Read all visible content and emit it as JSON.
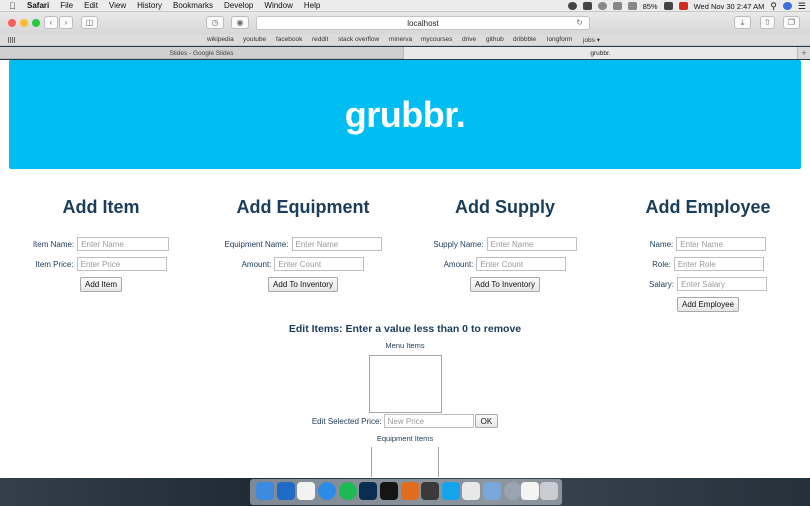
{
  "menubar": {
    "app": "Safari",
    "menus": [
      "File",
      "Edit",
      "View",
      "History",
      "Bookmarks",
      "Develop",
      "Window",
      "Help"
    ],
    "battery": "85%",
    "datetime": "Wed Nov 30  2:47 AM"
  },
  "browser": {
    "url": "localhost",
    "favorites": [
      "wikipedia",
      "youtube",
      "facebook",
      "reddit",
      "stack overflow",
      "minerva",
      "mycourses",
      "drive",
      "github",
      "dribbble",
      "longform",
      "jobs ▾"
    ],
    "tabs": [
      "Slides - Google Slides",
      "grubbr."
    ],
    "new_tab": "+"
  },
  "page": {
    "brand": "grubbr.",
    "add_item": {
      "title": "Add Item",
      "name_label": "Item Name:",
      "name_placeholder": "Enter Name",
      "price_label": "Item Price:",
      "price_placeholder": "Enter Price",
      "button": "Add Item"
    },
    "add_equipment": {
      "title": "Add Equipment",
      "name_label": "Equipment Name:",
      "name_placeholder": "Enter Name",
      "amount_label": "Amount:",
      "amount_placeholder": "Enter Count",
      "button": "Add To Inventory"
    },
    "add_supply": {
      "title": "Add Supply",
      "name_label": "Supply Name:",
      "name_placeholder": "Enter Name",
      "amount_label": "Amount:",
      "amount_placeholder": "Enter Count",
      "button": "Add To Inventory"
    },
    "add_employee": {
      "title": "Add Employee",
      "name_label": "Name:",
      "name_placeholder": "Enter Name",
      "role_label": "Role:",
      "role_placeholder": "Enter Role",
      "salary_label": "Salary:",
      "salary_placeholder": "Enter Salary",
      "button": "Add Employee"
    },
    "edit_items": {
      "title": "Edit Items: Enter a value less than 0 to remove",
      "menu_items_label": "Menu Items",
      "edit_price_label": "Edit Selected Price:",
      "edit_price_placeholder": "New Price",
      "ok_button": "OK",
      "equipment_items_label": "Equipment Items"
    }
  },
  "colors": {
    "hero": "#00bdf2",
    "heading": "#1a3d5c"
  },
  "dock": {
    "icons": [
      "finder-icon",
      "outlook-icon",
      "calendar-icon",
      "safari-icon",
      "spotify-icon",
      "photoshop-icon",
      "terminal-icon",
      "sublime-icon",
      "video-icon",
      "skype-icon",
      "slack-icon",
      "preview-icon",
      "settings-icon",
      "documents-icon",
      "trash-icon"
    ]
  }
}
